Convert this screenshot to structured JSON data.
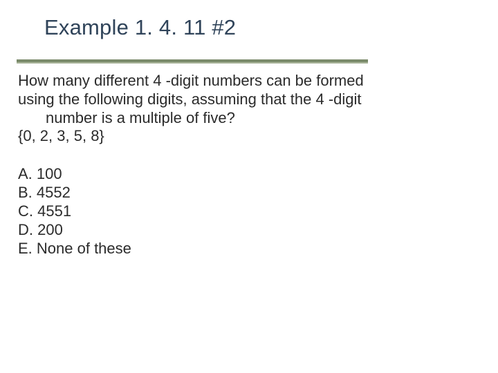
{
  "title": "Example 1. 4. 11 #2",
  "question": {
    "line1": "How many different 4 -digit numbers can be formed",
    "line2": "using the following digits, assuming that the 4 -digit",
    "line3": "number is a multiple of five?",
    "digits": "{0, 2, 3, 5, 8}"
  },
  "options": {
    "a": "A. 100",
    "b": "B. 4552",
    "c": "C. 4551",
    "d": "D. 200",
    "e": "E. None of these"
  }
}
